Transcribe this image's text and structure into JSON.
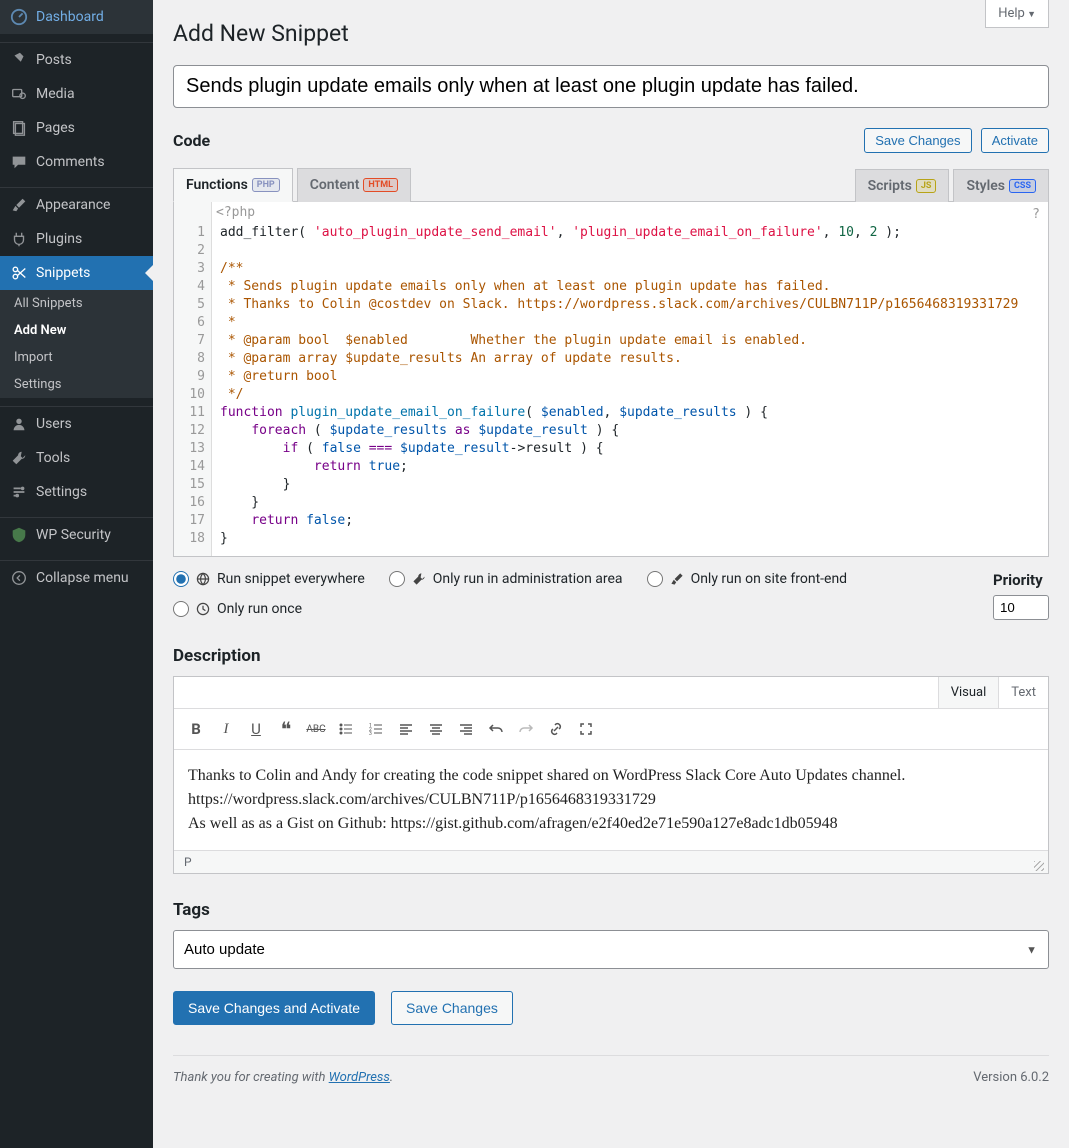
{
  "help_label": "Help",
  "sidebar": {
    "items": [
      {
        "label": "Dashboard",
        "icon": "dashboard"
      },
      {
        "label": "Posts",
        "icon": "pin"
      },
      {
        "label": "Media",
        "icon": "media"
      },
      {
        "label": "Pages",
        "icon": "pages"
      },
      {
        "label": "Comments",
        "icon": "comments"
      },
      {
        "label": "Appearance",
        "icon": "brush"
      },
      {
        "label": "Plugins",
        "icon": "plug"
      },
      {
        "label": "Snippets",
        "icon": "scissors"
      },
      {
        "label": "Users",
        "icon": "users"
      },
      {
        "label": "Tools",
        "icon": "tools"
      },
      {
        "label": "Settings",
        "icon": "settings"
      },
      {
        "label": "WP Security",
        "icon": "shield"
      },
      {
        "label": "Collapse menu",
        "icon": "collapse"
      }
    ],
    "sub": [
      {
        "label": "All Snippets"
      },
      {
        "label": "Add New"
      },
      {
        "label": "Import"
      },
      {
        "label": "Settings"
      }
    ]
  },
  "page_title": "Add New Snippet",
  "snippet_title": "Sends plugin update emails only when at least one plugin update has failed.",
  "code_heading": "Code",
  "save_changes": "Save Changes",
  "activate": "Activate",
  "tabs": {
    "functions": "Functions",
    "content": "Content",
    "scripts": "Scripts",
    "styles": "Styles",
    "badges": {
      "php": "PHP",
      "html": "HTML",
      "js": "JS",
      "css": "CSS"
    }
  },
  "editor_header": "<?php",
  "editor_help": "?",
  "code_lines": [
    {
      "n": 1,
      "segs": [
        {
          "t": "add_filter( ",
          "c": ""
        },
        {
          "t": "'auto_plugin_update_send_email'",
          "c": "tok-str"
        },
        {
          "t": ", ",
          "c": ""
        },
        {
          "t": "'plugin_update_email_on_failure'",
          "c": "tok-str"
        },
        {
          "t": ", ",
          "c": ""
        },
        {
          "t": "10",
          "c": "tok-num"
        },
        {
          "t": ", ",
          "c": ""
        },
        {
          "t": "2",
          "c": "tok-num"
        },
        {
          "t": " );",
          "c": ""
        }
      ]
    },
    {
      "n": 2,
      "segs": []
    },
    {
      "n": 3,
      "segs": [
        {
          "t": "/**",
          "c": "tok-cm"
        }
      ]
    },
    {
      "n": 4,
      "segs": [
        {
          "t": " * Sends plugin update emails only when at least one plugin update has failed.",
          "c": "tok-cm"
        }
      ]
    },
    {
      "n": 5,
      "segs": [
        {
          "t": " * Thanks to Colin @costdev on Slack. https://wordpress.slack.com/archives/CULBN711P/p1656468319331729",
          "c": "tok-cm"
        }
      ]
    },
    {
      "n": 6,
      "segs": [
        {
          "t": " *",
          "c": "tok-cm"
        }
      ]
    },
    {
      "n": 7,
      "segs": [
        {
          "t": " * @param bool  $enabled        Whether the plugin update email is enabled.",
          "c": "tok-cm"
        }
      ]
    },
    {
      "n": 8,
      "segs": [
        {
          "t": " * @param array $update_results An array of update results.",
          "c": "tok-cm"
        }
      ]
    },
    {
      "n": 9,
      "segs": [
        {
          "t": " * @return bool",
          "c": "tok-cm"
        }
      ]
    },
    {
      "n": 10,
      "segs": [
        {
          "t": " */",
          "c": "tok-cm"
        }
      ]
    },
    {
      "n": 11,
      "segs": [
        {
          "t": "function",
          "c": "tok-kw"
        },
        {
          "t": " ",
          "c": ""
        },
        {
          "t": "plugin_update_email_on_failure",
          "c": "tok-fn"
        },
        {
          "t": "( ",
          "c": ""
        },
        {
          "t": "$enabled",
          "c": "tok-var"
        },
        {
          "t": ", ",
          "c": ""
        },
        {
          "t": "$update_results",
          "c": "tok-var"
        },
        {
          "t": " ) {",
          "c": ""
        }
      ]
    },
    {
      "n": 12,
      "segs": [
        {
          "t": "    ",
          "c": ""
        },
        {
          "t": "foreach",
          "c": "tok-kw"
        },
        {
          "t": " ( ",
          "c": ""
        },
        {
          "t": "$update_results",
          "c": "tok-var"
        },
        {
          "t": " ",
          "c": ""
        },
        {
          "t": "as",
          "c": "tok-kw"
        },
        {
          "t": " ",
          "c": ""
        },
        {
          "t": "$update_result",
          "c": "tok-var"
        },
        {
          "t": " ) {",
          "c": ""
        }
      ]
    },
    {
      "n": 13,
      "segs": [
        {
          "t": "        ",
          "c": ""
        },
        {
          "t": "if",
          "c": "tok-kw"
        },
        {
          "t": " ( ",
          "c": ""
        },
        {
          "t": "false",
          "c": "tok-type"
        },
        {
          "t": " ",
          "c": ""
        },
        {
          "t": "===",
          "c": "tok-kw"
        },
        {
          "t": " ",
          "c": ""
        },
        {
          "t": "$update_result",
          "c": "tok-var"
        },
        {
          "t": "->result ) {",
          "c": ""
        }
      ]
    },
    {
      "n": 14,
      "segs": [
        {
          "t": "            ",
          "c": ""
        },
        {
          "t": "return",
          "c": "tok-kw"
        },
        {
          "t": " ",
          "c": ""
        },
        {
          "t": "true",
          "c": "tok-type"
        },
        {
          "t": ";",
          "c": ""
        }
      ]
    },
    {
      "n": 15,
      "segs": [
        {
          "t": "        }",
          "c": ""
        }
      ]
    },
    {
      "n": 16,
      "segs": [
        {
          "t": "    }",
          "c": ""
        }
      ]
    },
    {
      "n": 17,
      "segs": [
        {
          "t": "    ",
          "c": ""
        },
        {
          "t": "return",
          "c": "tok-kw"
        },
        {
          "t": " ",
          "c": ""
        },
        {
          "t": "false",
          "c": "tok-type"
        },
        {
          "t": ";",
          "c": ""
        }
      ]
    },
    {
      "n": 18,
      "segs": [
        {
          "t": "}",
          "c": ""
        }
      ]
    }
  ],
  "scope": {
    "opts": [
      {
        "label": "Run snippet everywhere",
        "checked": true,
        "icon": "globe"
      },
      {
        "label": "Only run in administration area",
        "checked": false,
        "icon": "wrench"
      },
      {
        "label": "Only run on site front-end",
        "checked": false,
        "icon": "eye"
      },
      {
        "label": "Only run once",
        "checked": false,
        "icon": "clock"
      }
    ]
  },
  "priority_label": "Priority",
  "priority_value": "10",
  "description_heading": "Description",
  "desc_tabs": {
    "visual": "Visual",
    "text": "Text"
  },
  "description_body": "Thanks to Colin and Andy for creating the code snippet shared on WordPress Slack Core Auto Updates channel.\nhttps://wordpress.slack.com/archives/CULBN711P/p1656468319331729\nAs well as as a Gist on Github: https://gist.github.com/afragen/e2f40ed2e71e590a127e8adc1db05948",
  "desc_status": "P",
  "tags_heading": "Tags",
  "tags_value": "Auto update",
  "save_activate": "Save Changes and Activate",
  "footer_thanks": "Thank you for creating with ",
  "footer_wp": "WordPress",
  "footer_dot": ".",
  "footer_version": "Version 6.0.2"
}
